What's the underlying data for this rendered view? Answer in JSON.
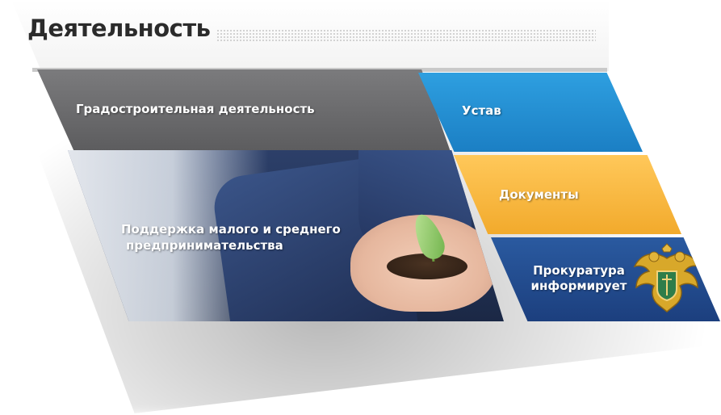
{
  "header": {
    "title": "Деятельность"
  },
  "tiles": {
    "urban": {
      "label": "Градостроительная деятельность"
    },
    "charter": {
      "label": "Устав"
    },
    "docs": {
      "label": "Документы"
    },
    "sme": {
      "label_line1": "Поддержка малого и среднего",
      "label_line2": "предпринимательства"
    },
    "prosecutor": {
      "label_line1": "Прокуратура",
      "label_line2": "информирует"
    }
  },
  "colors": {
    "urban": "#6b6b6d",
    "charter": "#2490d6",
    "docs": "#f6b63c",
    "prosecutor": "#22498f",
    "title_text": "#2b2b2b"
  },
  "icons": {
    "emblem": "double-headed-eagle-emblem-icon",
    "sme_image": "hands-with-sprout-image"
  }
}
